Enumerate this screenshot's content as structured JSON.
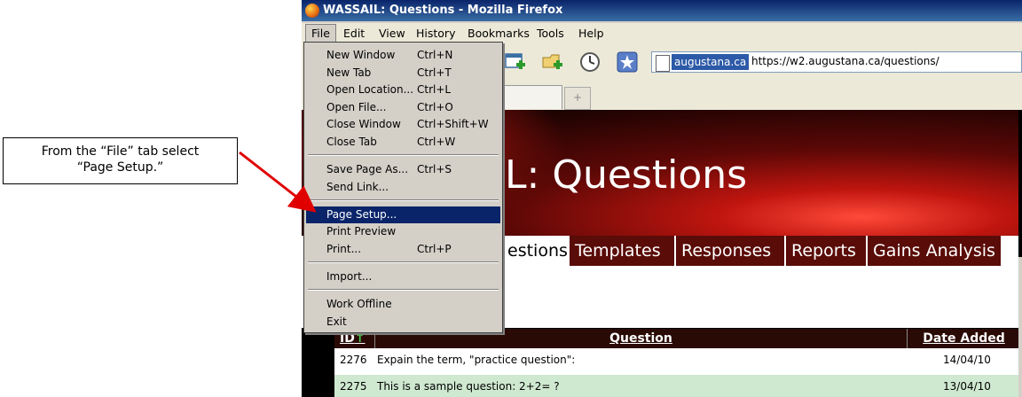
{
  "callout": {
    "line1": "From the “File” tab select",
    "line2": "“Page Setup.”"
  },
  "window": {
    "title": "WASSAIL: Questions - Mozilla Firefox"
  },
  "menubar": [
    "File",
    "Edit",
    "View",
    "History",
    "Bookmarks",
    "Tools",
    "Help"
  ],
  "urlbar": {
    "site": "augustana.ca",
    "address": "https://w2.augustana.ca/questions/"
  },
  "file_menu": [
    {
      "label": "New Window",
      "shortcut": "Ctrl+N"
    },
    {
      "label": "New Tab",
      "shortcut": "Ctrl+T"
    },
    {
      "label": "Open Location...",
      "shortcut": "Ctrl+L"
    },
    {
      "label": "Open File...",
      "shortcut": "Ctrl+O"
    },
    {
      "label": "Close Window",
      "shortcut": "Ctrl+Shift+W"
    },
    {
      "label": "Close Tab",
      "shortcut": "Ctrl+W"
    },
    {
      "label": "Save Page As...",
      "shortcut": "Ctrl+S"
    },
    {
      "label": "Send Link...",
      "shortcut": ""
    },
    {
      "label": "Page Setup...",
      "shortcut": "",
      "highlighted": true
    },
    {
      "label": "Print Preview",
      "shortcut": ""
    },
    {
      "label": "Print...",
      "shortcut": "Ctrl+P"
    },
    {
      "label": "Import...",
      "shortcut": ""
    },
    {
      "label": "Work Offline",
      "shortcut": ""
    },
    {
      "label": "Exit",
      "shortcut": ""
    }
  ],
  "page": {
    "banner_title": "L: Questions",
    "nav_tabs": [
      "estions",
      "Templates",
      "Responses",
      "Reports",
      "Gains Analysis"
    ],
    "table": {
      "headers": [
        "ID",
        "Question",
        "Date Added"
      ],
      "rows": [
        {
          "id": "2276",
          "question": "Expain the term, \"practice question\":",
          "date": "14/04/10"
        },
        {
          "id": "2275",
          "question": "This is a sample question: 2+2= ?",
          "date": "13/04/10"
        }
      ]
    }
  },
  "colors": {
    "highlight": "#0a246a",
    "nav_tab": "#5a0c08",
    "arrow": "#e00000"
  }
}
